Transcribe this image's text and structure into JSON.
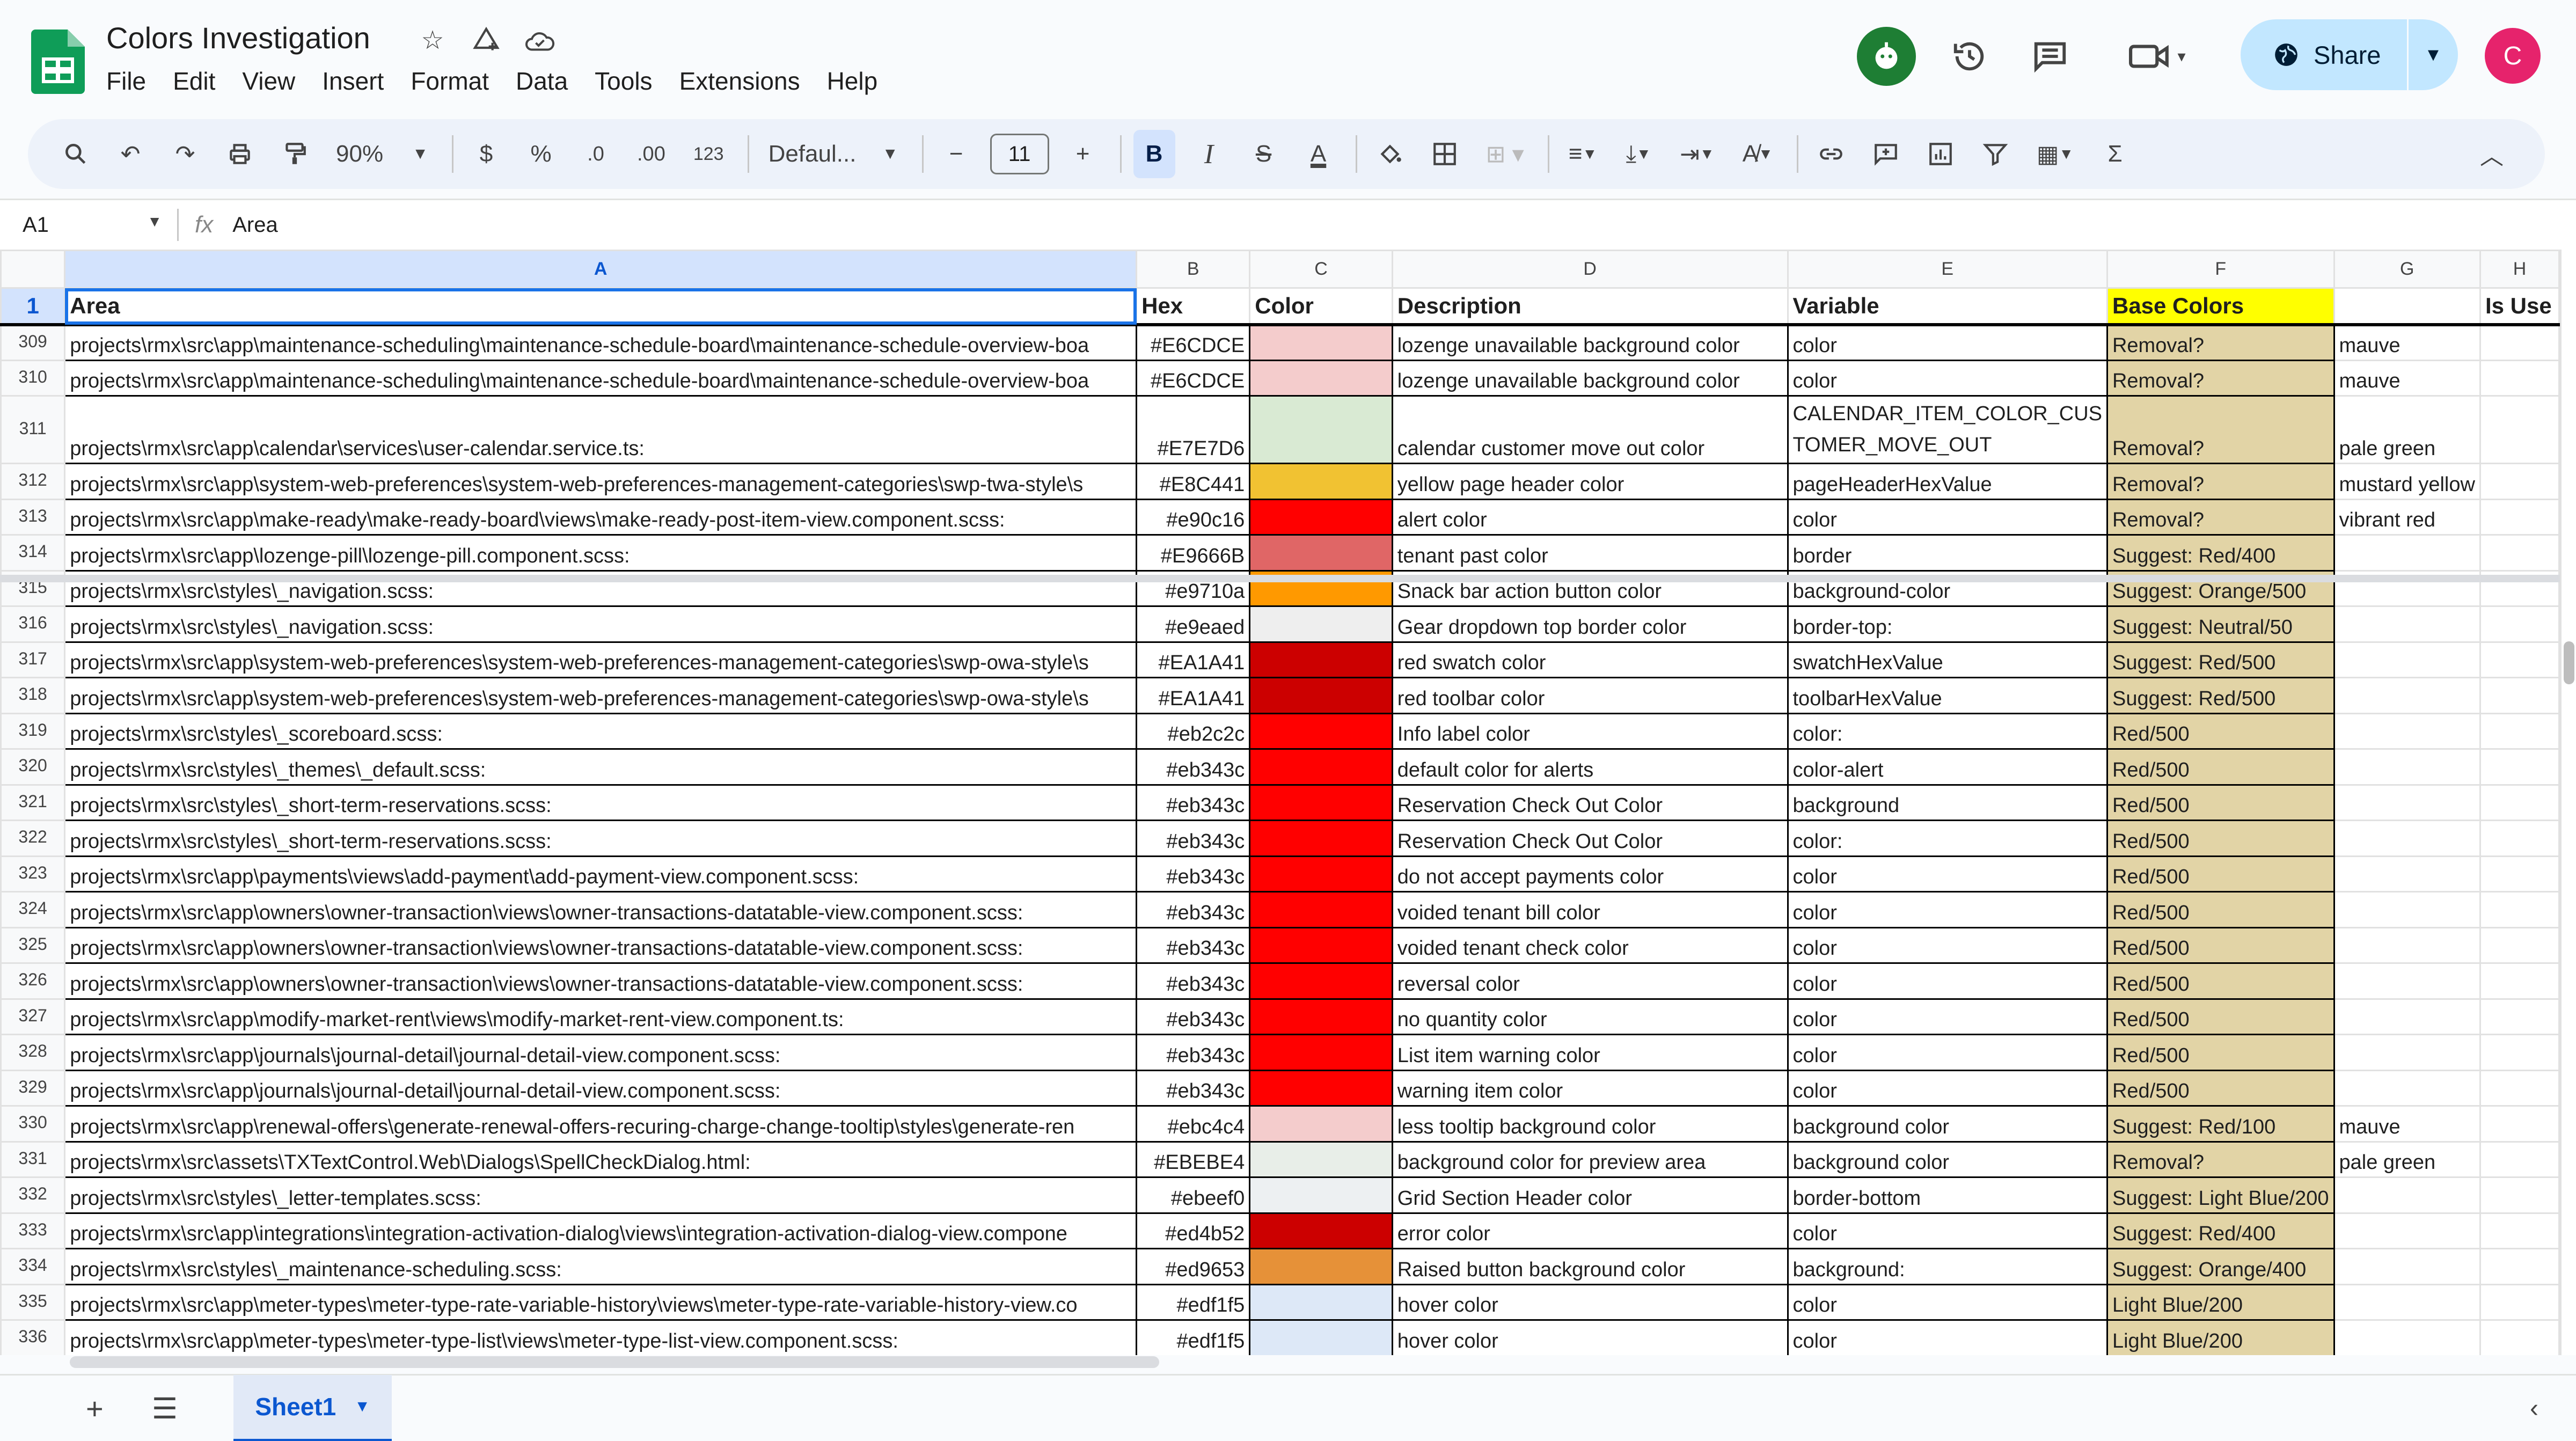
{
  "app": {
    "doc_title": "Colors Investigation",
    "menu": [
      "File",
      "Edit",
      "View",
      "Insert",
      "Format",
      "Data",
      "Tools",
      "Extensions",
      "Help"
    ],
    "share_label": "Share",
    "avatar_letter": "C"
  },
  "toolbar": {
    "zoom": "90%",
    "currency": "$",
    "percent": "%",
    "dec_decrease": ".0",
    "dec_increase": ".00",
    "more_formats": "123",
    "font": "Defaul...",
    "font_size": "11",
    "bold": "B",
    "italic": "I",
    "strike": "S",
    "text_color": "A",
    "functions": "Σ"
  },
  "formula_bar": {
    "cell_ref": "A1",
    "fx": "fx",
    "content": "Area"
  },
  "columns": [
    "A",
    "B",
    "C",
    "D",
    "E",
    "F",
    "G",
    "H"
  ],
  "header_row": {
    "num": "1",
    "cells": [
      "Area",
      "Hex",
      "Color",
      "Description",
      "Variable",
      "Base Colors",
      "",
      "Is Use"
    ]
  },
  "rows": [
    {
      "num": "309",
      "area": "projects\\rmx\\src\\app\\maintenance-scheduling\\maintenance-schedule-board\\maintenance-schedule-overview-boa",
      "hex": "#E6CDCE",
      "color": "#f4cccc",
      "desc": "lozenge unavailable background color",
      "var": "color",
      "base": "Removal?",
      "g": "mauve"
    },
    {
      "num": "310",
      "area": "projects\\rmx\\src\\app\\maintenance-scheduling\\maintenance-schedule-board\\maintenance-schedule-overview-boa",
      "hex": "#E6CDCE",
      "color": "#f4cccc",
      "desc": "lozenge unavailable background color",
      "var": "color",
      "base": "Removal?",
      "g": "mauve"
    },
    {
      "num": "311",
      "area": "projects\\rmx\\src\\app\\calendar\\services\\user-calendar.service.ts:",
      "hex": "#E7E7D6",
      "color": "#d9ead3",
      "desc": "calendar customer move out color",
      "var": "CALENDAR_ITEM_COLOR_CUS",
      "var2": "TOMER_MOVE_OUT",
      "base": "Removal?",
      "g": "pale green",
      "tall": true
    },
    {
      "num": "312",
      "area": "projects\\rmx\\src\\app\\system-web-preferences\\system-web-preferences-management-categories\\swp-twa-style\\s",
      "hex": "#E8C441",
      "color": "#f1c232",
      "desc": "yellow page header color",
      "var": "pageHeaderHexValue",
      "base": "Removal?",
      "g": "mustard yellow"
    },
    {
      "num": "313",
      "area": "projects\\rmx\\src\\app\\make-ready\\make-ready-board\\views\\make-ready-post-item-view.component.scss:",
      "hex": "#e90c16",
      "color": "#ff0000",
      "desc": "alert color",
      "var": "color",
      "base": "Removal?",
      "g": "vibrant red"
    },
    {
      "num": "314",
      "area": "projects\\rmx\\src\\app\\lozenge-pill\\lozenge-pill.component.scss:",
      "hex": "#E9666B",
      "color": "#e06666",
      "desc": "tenant past color",
      "var": "border",
      "base": "Suggest: Red/400",
      "g": ""
    },
    {
      "num": "315",
      "area": "projects\\rmx\\src\\styles\\_navigation.scss:",
      "hex": "#e9710a",
      "color": "#ff9900",
      "desc": "Snack bar action button color",
      "var": "background-color",
      "base": "Suggest: Orange/500",
      "g": ""
    },
    {
      "num": "316",
      "area": "projects\\rmx\\src\\styles\\_navigation.scss:",
      "hex": "#e9eaed",
      "color": "#eeeeee",
      "desc": "Gear dropdown top border color",
      "var": "border-top:",
      "base": "Suggest: Neutral/50",
      "g": ""
    },
    {
      "num": "317",
      "area": "projects\\rmx\\src\\app\\system-web-preferences\\system-web-preferences-management-categories\\swp-owa-style\\s",
      "hex": "#EA1A41",
      "color": "#cc0000",
      "desc": "red swatch color",
      "var": "swatchHexValue",
      "base": "Suggest: Red/500",
      "g": ""
    },
    {
      "num": "318",
      "area": "projects\\rmx\\src\\app\\system-web-preferences\\system-web-preferences-management-categories\\swp-owa-style\\s",
      "hex": "#EA1A41",
      "color": "#cc0000",
      "desc": "red toolbar color",
      "var": "toolbarHexValue",
      "base": "Suggest: Red/500",
      "g": ""
    },
    {
      "num": "319",
      "area": "projects\\rmx\\src\\styles\\_scoreboard.scss:",
      "hex": "#eb2c2c",
      "color": "#ff0000",
      "desc": "Info label color",
      "var": "color:",
      "base": "Red/500",
      "g": ""
    },
    {
      "num": "320",
      "area": "projects\\rmx\\src\\styles\\_themes\\_default.scss:",
      "hex": "#eb343c",
      "color": "#ff0000",
      "desc": "default color for alerts",
      "var": "color-alert",
      "base": "Red/500",
      "g": ""
    },
    {
      "num": "321",
      "area": "projects\\rmx\\src\\styles\\_short-term-reservations.scss:",
      "hex": "#eb343c",
      "color": "#ff0000",
      "desc": "Reservation Check Out Color",
      "var": "background",
      "base": "Red/500",
      "g": ""
    },
    {
      "num": "322",
      "area": "projects\\rmx\\src\\styles\\_short-term-reservations.scss:",
      "hex": "#eb343c",
      "color": "#ff0000",
      "desc": "Reservation Check Out Color",
      "var": "color:",
      "base": "Red/500",
      "g": ""
    },
    {
      "num": "323",
      "area": "projects\\rmx\\src\\app\\payments\\views\\add-payment\\add-payment-view.component.scss:",
      "hex": "#eb343c",
      "color": "#ff0000",
      "desc": "do not accept payments color",
      "var": "color",
      "base": "Red/500",
      "g": ""
    },
    {
      "num": "324",
      "area": "projects\\rmx\\src\\app\\owners\\owner-transaction\\views\\owner-transactions-datatable-view.component.scss:",
      "hex": "#eb343c",
      "color": "#ff0000",
      "desc": "voided tenant bill color",
      "var": "color",
      "base": "Red/500",
      "g": ""
    },
    {
      "num": "325",
      "area": "projects\\rmx\\src\\app\\owners\\owner-transaction\\views\\owner-transactions-datatable-view.component.scss:",
      "hex": "#eb343c",
      "color": "#ff0000",
      "desc": "voided tenant check color",
      "var": "color",
      "base": "Red/500",
      "g": ""
    },
    {
      "num": "326",
      "area": "projects\\rmx\\src\\app\\owners\\owner-transaction\\views\\owner-transactions-datatable-view.component.scss:",
      "hex": "#eb343c",
      "color": "#ff0000",
      "desc": "reversal color",
      "var": "color",
      "base": "Red/500",
      "g": ""
    },
    {
      "num": "327",
      "area": "projects\\rmx\\src\\app\\modify-market-rent\\views\\modify-market-rent-view.component.ts:",
      "hex": "#eb343c",
      "color": "#ff0000",
      "desc": "no quantity color",
      "var": "color",
      "base": "Red/500",
      "g": ""
    },
    {
      "num": "328",
      "area": "projects\\rmx\\src\\app\\journals\\journal-detail\\journal-detail-view.component.scss:",
      "hex": "#eb343c",
      "color": "#ff0000",
      "desc": "List item warning color",
      "var": "color",
      "base": "Red/500",
      "g": ""
    },
    {
      "num": "329",
      "area": "projects\\rmx\\src\\app\\journals\\journal-detail\\journal-detail-view.component.scss:",
      "hex": "#eb343c",
      "color": "#ff0000",
      "desc": "warning item color",
      "var": "color",
      "base": "Red/500",
      "g": ""
    },
    {
      "num": "330",
      "area": "projects\\rmx\\src\\app\\renewal-offers\\generate-renewal-offers-recuring-charge-change-tooltip\\styles\\generate-ren",
      "hex": "#ebc4c4",
      "color": "#f4cccc",
      "desc": "less tooltip background color",
      "var": "background color",
      "base": "Suggest: Red/100",
      "g": "mauve"
    },
    {
      "num": "331",
      "area": "projects\\rmx\\src\\assets\\TXTextControl.Web\\Dialogs\\SpellCheckDialog.html:",
      "hex": "#EBEBE4",
      "color": "#e8eee8",
      "desc": "background color for preview area",
      "var": "background color",
      "base": "Removal?",
      "g": "pale green"
    },
    {
      "num": "332",
      "area": "projects\\rmx\\src\\styles\\_letter-templates.scss:",
      "hex": "#ebeef0",
      "color": "#edf0f2",
      "desc": "Grid Section Header color",
      "var": "border-bottom",
      "base": "Suggest: Light Blue/200",
      "g": ""
    },
    {
      "num": "333",
      "area": "projects\\rmx\\src\\app\\integrations\\integration-activation-dialog\\views\\integration-activation-dialog-view.compone",
      "hex": "#ed4b52",
      "color": "#cc0000",
      "desc": "error color",
      "var": "color",
      "base": "Suggest: Red/400",
      "g": ""
    },
    {
      "num": "334",
      "area": "projects\\rmx\\src\\styles\\_maintenance-scheduling.scss:",
      "hex": "#ed9653",
      "color": "#e69138",
      "desc": "Raised button background color",
      "var": "background:",
      "base": "Suggest: Orange/400",
      "g": ""
    },
    {
      "num": "335",
      "area": "projects\\rmx\\src\\app\\meter-types\\meter-type-rate-variable-history\\views\\meter-type-rate-variable-history-view.co",
      "hex": "#edf1f5",
      "color": "#dde8f7",
      "desc": "hover color",
      "var": "color",
      "base": "Light Blue/200",
      "g": ""
    },
    {
      "num": "336",
      "area": "projects\\rmx\\src\\app\\meter-types\\meter-type-list\\views\\meter-type-list-view.component.scss:",
      "hex": "#edf1f5",
      "color": "#dde8f7",
      "desc": "hover color",
      "var": "color",
      "base": "Light Blue/200",
      "g": ""
    }
  ],
  "sheet_tab": "Sheet1"
}
